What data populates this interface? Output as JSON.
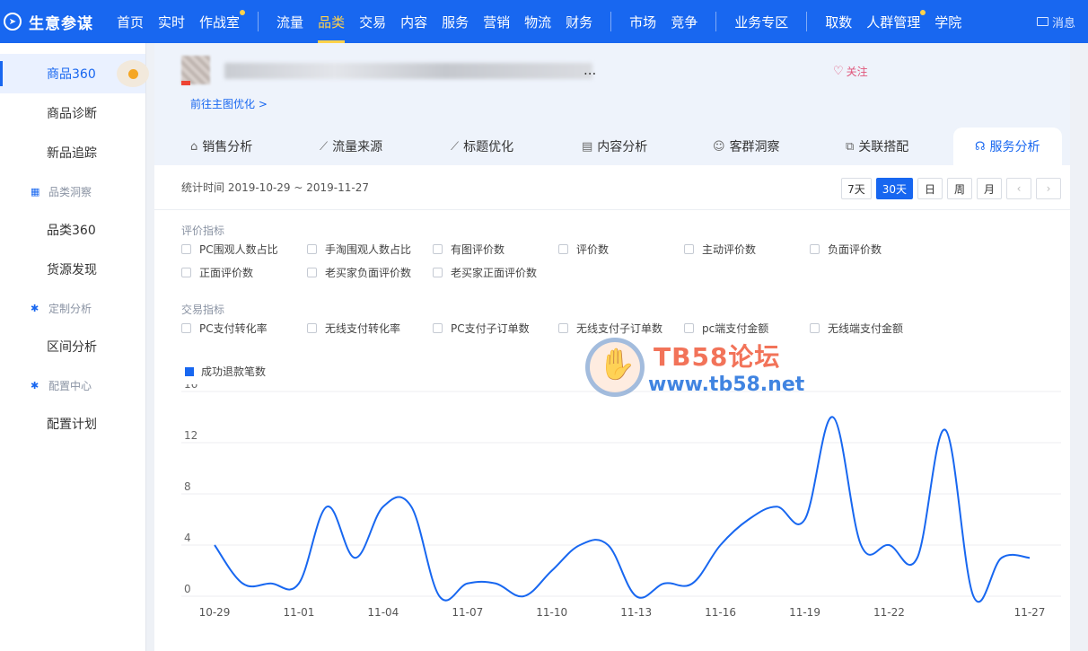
{
  "brand": {
    "name": "生意参谋",
    "logo_icon": "compass-icon"
  },
  "nav": {
    "group1": [
      {
        "label": "首页",
        "active": false,
        "dot": false
      },
      {
        "label": "实时",
        "active": false,
        "dot": false
      },
      {
        "label": "作战室",
        "active": false,
        "dot": true
      }
    ],
    "group2": [
      {
        "label": "流量",
        "active": false,
        "dot": false
      },
      {
        "label": "品类",
        "active": true,
        "dot": false
      },
      {
        "label": "交易",
        "active": false,
        "dot": false
      },
      {
        "label": "内容",
        "active": false,
        "dot": false
      },
      {
        "label": "服务",
        "active": false,
        "dot": false
      },
      {
        "label": "营销",
        "active": false,
        "dot": false
      },
      {
        "label": "物流",
        "active": false,
        "dot": false
      },
      {
        "label": "财务",
        "active": false,
        "dot": false
      }
    ],
    "group3": [
      {
        "label": "市场",
        "active": false,
        "dot": false
      },
      {
        "label": "竞争",
        "active": false,
        "dot": false
      }
    ],
    "group4": [
      {
        "label": "业务专区",
        "active": false,
        "dot": false
      }
    ],
    "group5": [
      {
        "label": "取数",
        "active": false,
        "dot": false
      },
      {
        "label": "人群管理",
        "active": false,
        "dot": true
      },
      {
        "label": "学院",
        "active": false,
        "dot": false
      }
    ],
    "messages_label": "消息"
  },
  "sidebar": {
    "items": [
      {
        "type": "item",
        "label": "商品360",
        "active": true
      },
      {
        "type": "item",
        "label": "商品诊断"
      },
      {
        "type": "item",
        "label": "新品追踪"
      },
      {
        "type": "section",
        "label": "品类洞察",
        "icon": "grid-icon"
      },
      {
        "type": "item",
        "label": "品类360"
      },
      {
        "type": "item",
        "label": "货源发现"
      },
      {
        "type": "section",
        "label": "定制分析",
        "icon": "gear-icon"
      },
      {
        "type": "item",
        "label": "区间分析"
      },
      {
        "type": "section",
        "label": "配置中心",
        "icon": "gear-icon"
      },
      {
        "type": "item",
        "label": "配置计划"
      }
    ]
  },
  "product": {
    "title_partial": "...",
    "follow_label": "关注",
    "main_pic_link": "前往主图优化 >"
  },
  "tabs": [
    {
      "label": "销售分析",
      "icon": "bag-icon",
      "active": false
    },
    {
      "label": "流量来源",
      "icon": "line-chart-icon",
      "active": false
    },
    {
      "label": "标题优化",
      "icon": "line-chart-icon",
      "active": false
    },
    {
      "label": "内容分析",
      "icon": "document-icon",
      "active": false
    },
    {
      "label": "客群洞察",
      "icon": "users-icon",
      "active": false
    },
    {
      "label": "关联搭配",
      "icon": "link-icon",
      "active": false
    },
    {
      "label": "服务分析",
      "icon": "headset-icon",
      "active": true
    }
  ],
  "stat": {
    "time_label": "统计时间 2019-10-29 ~ 2019-11-27"
  },
  "range_buttons": [
    {
      "label": "7天",
      "active": false
    },
    {
      "label": "30天",
      "active": true
    },
    {
      "label": "日",
      "active": false
    },
    {
      "label": "周",
      "active": false
    },
    {
      "label": "月",
      "active": false
    }
  ],
  "metric_groups": [
    {
      "label": "评价指标",
      "rows": [
        [
          "PC围观人数占比",
          "手淘围观人数占比",
          "有图评价数",
          "评价数",
          "主动评价数",
          "负面评价数"
        ],
        [
          "正面评价数",
          "老买家负面评价数",
          "老买家正面评价数"
        ]
      ]
    },
    {
      "label": "交易指标",
      "rows": [
        [
          "PC支付转化率",
          "无线支付转化率",
          "PC支付子订单数",
          "无线支付子订单数",
          "pc端支付金额",
          "无线端支付金额"
        ]
      ]
    }
  ],
  "watermark": {
    "line1": "TB58论坛",
    "line2": "www.tb58.net"
  },
  "chart_data": {
    "type": "line",
    "title": "",
    "xlabel": "",
    "ylabel": "",
    "legend": "top-left",
    "color": "#1867f0",
    "grid": true,
    "x": [
      "10-29",
      "10-30",
      "10-31",
      "11-01",
      "11-02",
      "11-03",
      "11-04",
      "11-05",
      "11-06",
      "11-07",
      "11-08",
      "11-09",
      "11-10",
      "11-11",
      "11-12",
      "11-13",
      "11-14",
      "11-15",
      "11-16",
      "11-17",
      "11-18",
      "11-19",
      "11-20",
      "11-21",
      "11-22",
      "11-23",
      "11-24",
      "11-25",
      "11-26",
      "11-27"
    ],
    "x_tick_labels": [
      "10-29",
      "11-01",
      "11-04",
      "11-07",
      "11-10",
      "11-13",
      "11-16",
      "11-19",
      "11-22",
      "11-27"
    ],
    "series": [
      {
        "name": "成功退款笔数",
        "values": [
          4,
          1,
          1,
          1,
          7,
          3,
          7,
          7,
          0,
          1,
          1,
          0,
          2,
          4,
          4,
          0,
          1,
          1,
          4,
          6,
          7,
          6,
          14,
          4,
          4,
          3,
          13,
          0,
          3,
          3
        ]
      }
    ],
    "ylim": [
      0,
      16
    ],
    "yticks": [
      0,
      4,
      8,
      12,
      16
    ]
  }
}
